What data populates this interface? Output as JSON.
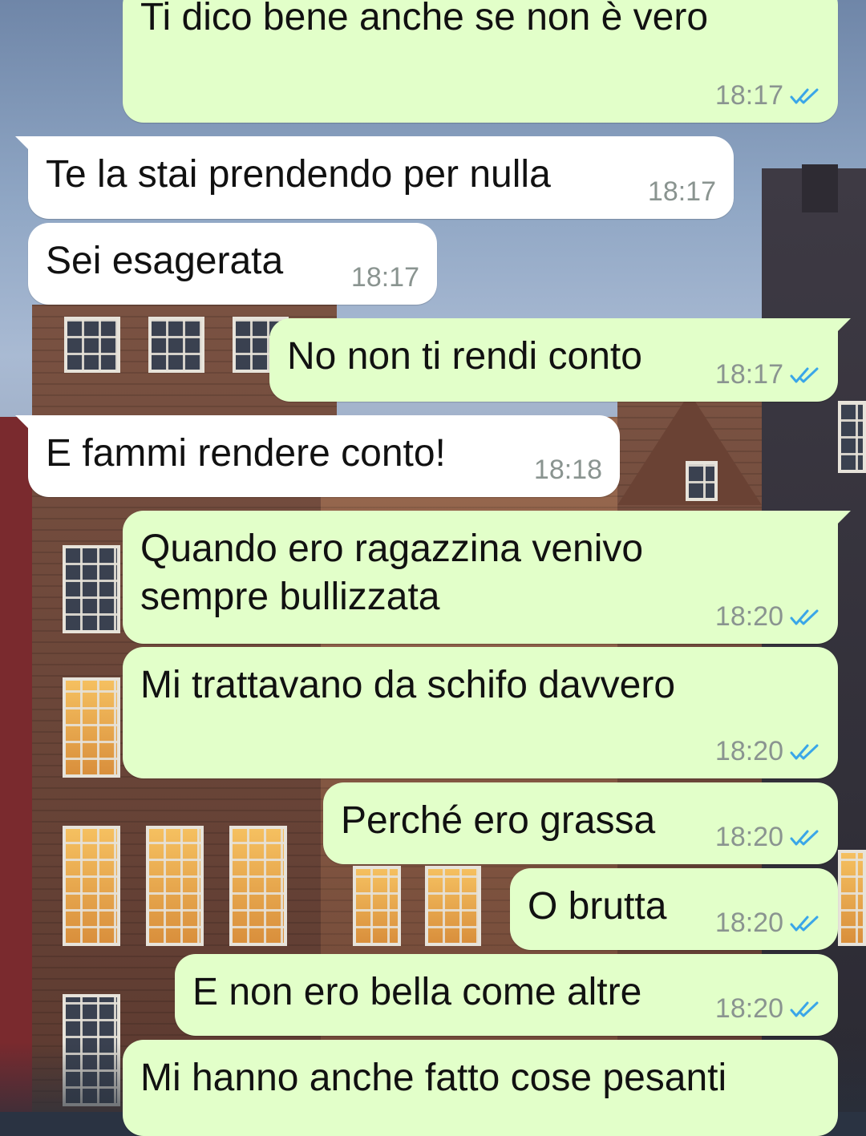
{
  "colors": {
    "outgoing_bubble": "#e2ffc9",
    "incoming_bubble": "#ffffff",
    "read_receipt": "#3aa6e8",
    "time_text": "#8a9490"
  },
  "messages": [
    {
      "direction": "out",
      "text": "Ti dico bene anche se non è vero",
      "time": "18:17",
      "status": "read-double-check-icon"
    },
    {
      "direction": "in",
      "text": "Te la stai prendendo per nulla",
      "time": "18:17"
    },
    {
      "direction": "in",
      "text": "Sei esagerata",
      "time": "18:17"
    },
    {
      "direction": "out",
      "text": "No non ti rendi conto",
      "time": "18:17",
      "status": "read-double-check-icon"
    },
    {
      "direction": "in",
      "text": "E fammi rendere conto!",
      "time": "18:18"
    },
    {
      "direction": "out",
      "text": "Quando ero ragazzina venivo\nsempre bullizzata",
      "time": "18:20",
      "status": "read-double-check-icon"
    },
    {
      "direction": "out",
      "text": "Mi trattavano da schifo davvero",
      "time": "18:20",
      "status": "read-double-check-icon"
    },
    {
      "direction": "out",
      "text": "Perché ero grassa",
      "time": "18:20",
      "status": "read-double-check-icon"
    },
    {
      "direction": "out",
      "text": "O brutta",
      "time": "18:20",
      "status": "read-double-check-icon"
    },
    {
      "direction": "out",
      "text": "E non ero bella come altre",
      "time": "18:20",
      "status": "read-double-check-icon"
    },
    {
      "direction": "out",
      "text": "Mi hanno anche fatto cose pesanti",
      "time": ""
    }
  ]
}
